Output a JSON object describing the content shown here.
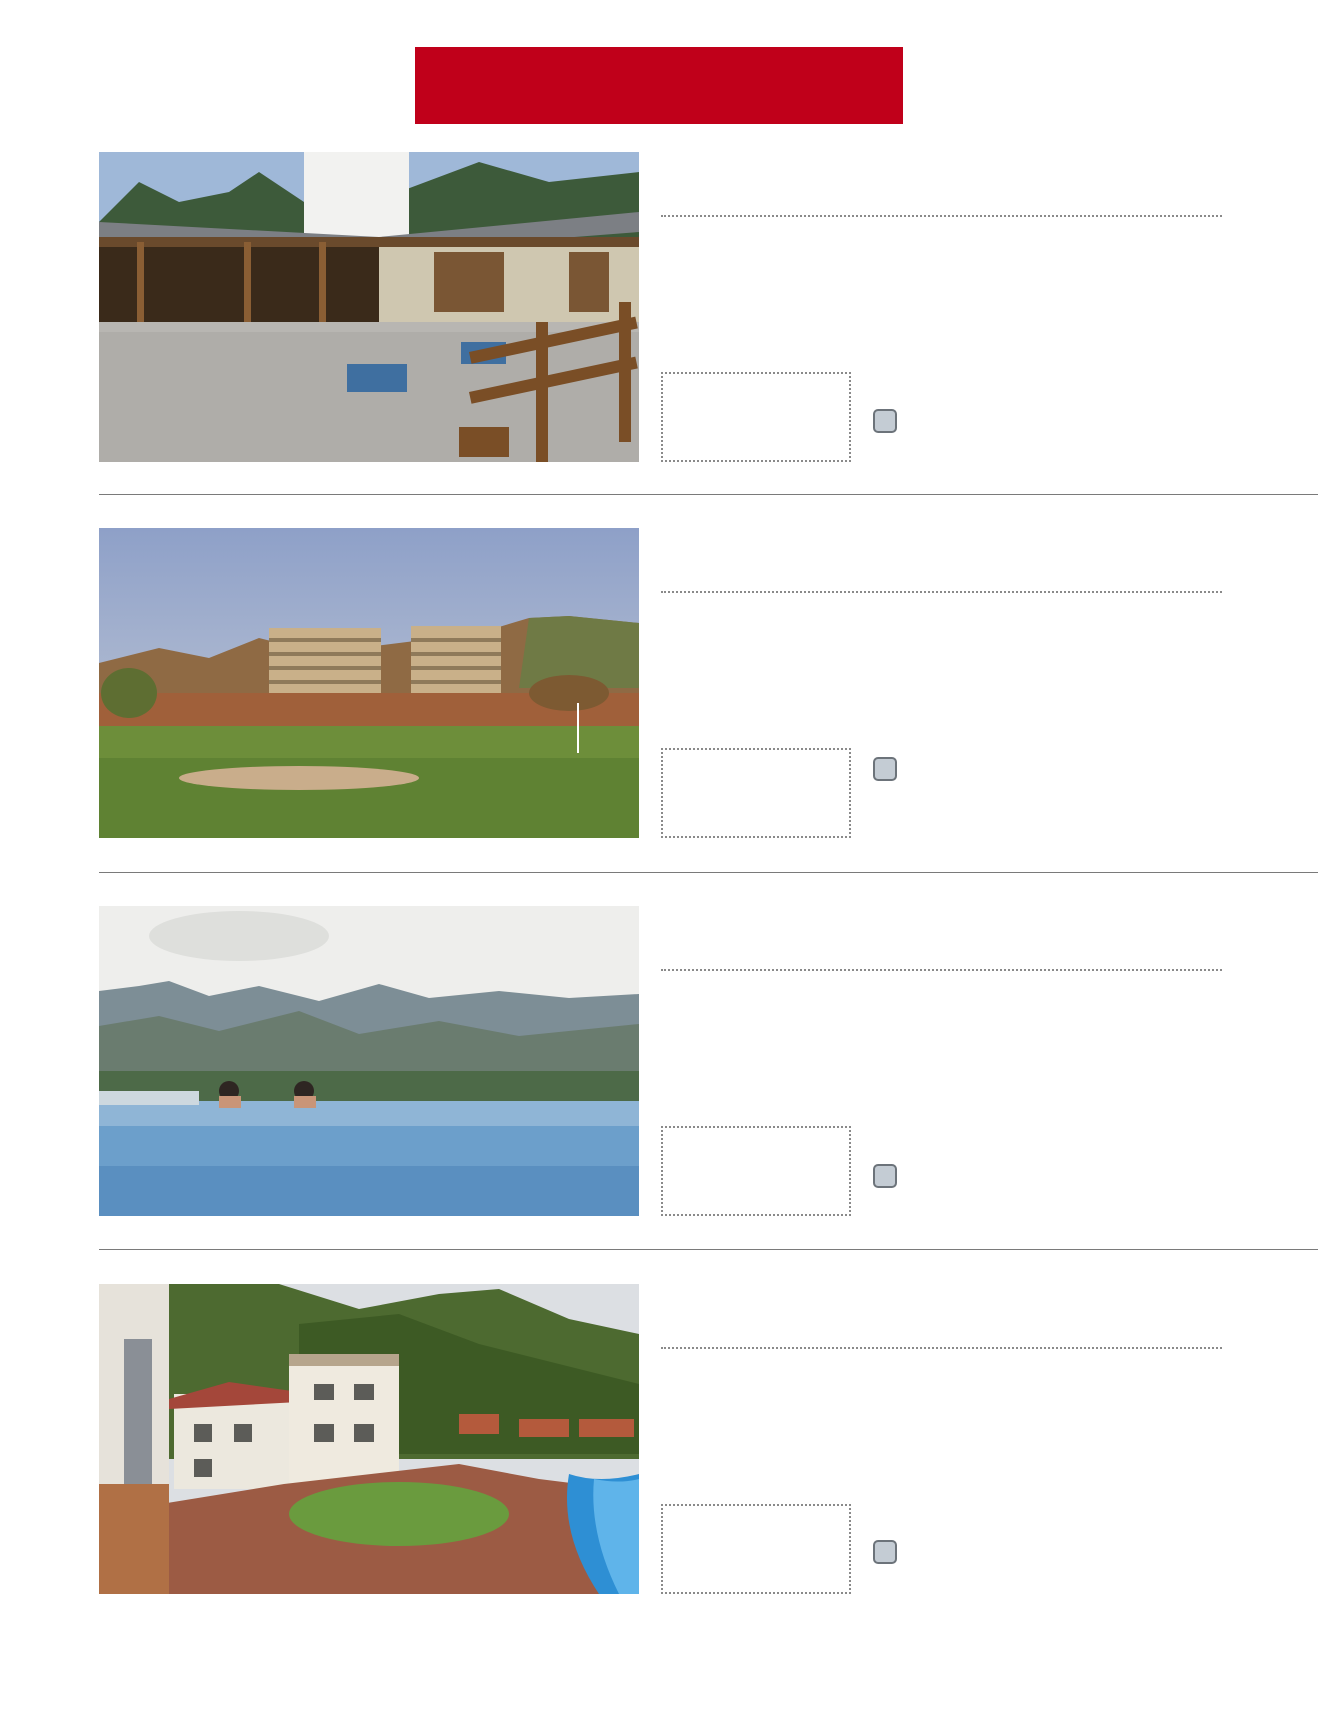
{
  "header": {
    "accent_color": "#c0001a"
  },
  "listings": [
    {
      "photo": "lodge-courtyard-photo",
      "checkbox_color": "#c4ccd4"
    },
    {
      "photo": "golf-course-apartments-photo",
      "checkbox_color": "#c4ccd4"
    },
    {
      "photo": "infinity-pool-mountains-photo",
      "checkbox_color": "#c4ccd4"
    },
    {
      "photo": "hillside-hotel-pool-photo",
      "checkbox_color": "#c4ccd4"
    }
  ]
}
